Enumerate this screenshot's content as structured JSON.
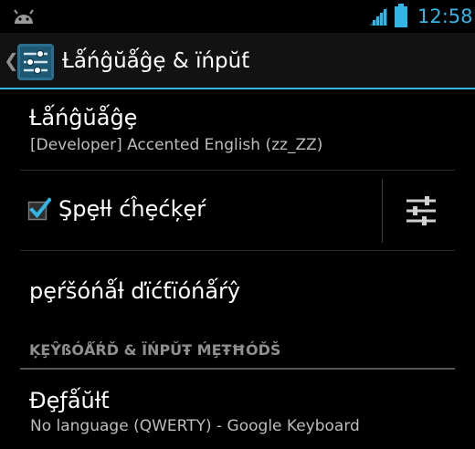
{
  "status_bar": {
    "time": "12:58",
    "icons": [
      "android-debug-icon",
      "signal-icon",
      "battery-icon"
    ]
  },
  "action_bar": {
    "title": "Ƚǻńĝŭǻĝȩ & ïńpŭƭ",
    "icons": [
      "back-caret-icon",
      "settings-sliders-icon"
    ]
  },
  "preferences": {
    "language": {
      "title": "Ƚǻńĝŭǻĝȩ",
      "summary": "[Developer] Accented English (zz_ZZ)"
    },
    "spell_checker": {
      "title": "Şpȩƚƚ ćĥȩćķȩŕ",
      "checked": true,
      "settings_icon": "sliders-icon"
    },
    "personal_dictionary": {
      "title": "pȩŕšóńǻƚ ďïćƭïóńǻŕŷ"
    }
  },
  "keyboard_section": {
    "header": "ĶȨŶßÓǺŔĎ & ÏŃPŬŦ ḾȨŦĦÓĎŠ",
    "default": {
      "title": "Đȩƒǻŭƚƭ",
      "summary": "No language (QWERTY) - Google Keyboard"
    }
  },
  "colors": {
    "accent": "#33b5e5",
    "background": "#000000",
    "action_bar": "#121212",
    "summary_text": "#bdbdbd",
    "category_text": "#8f8f8f"
  }
}
